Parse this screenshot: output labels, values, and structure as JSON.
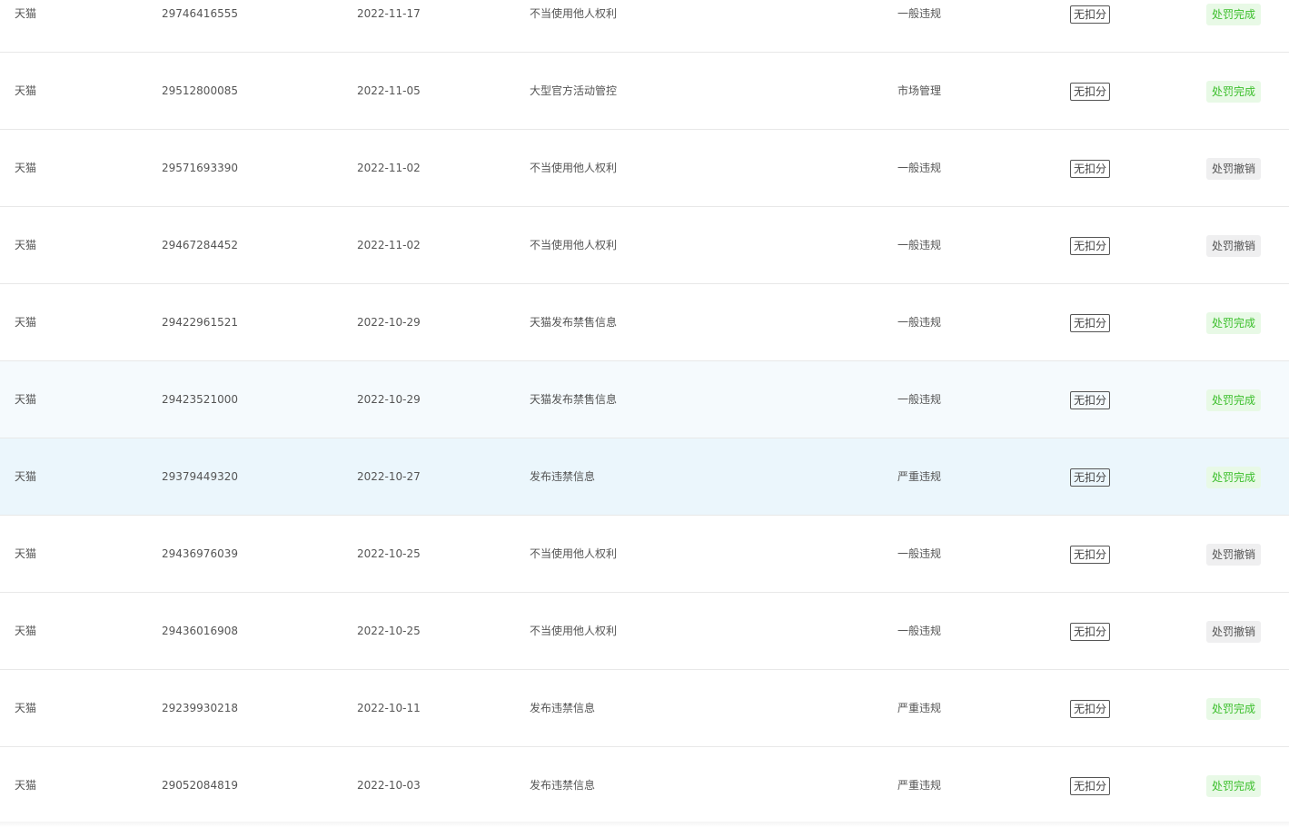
{
  "rows": [
    {
      "platform": "天猫",
      "id": "29746416555",
      "date": "2022-11-17",
      "reason": "不当使用他人权利",
      "level": "一般违规",
      "score": "无扣分",
      "status": "处罚完成",
      "status_type": "done"
    },
    {
      "platform": "天猫",
      "id": "29512800085",
      "date": "2022-11-05",
      "reason": "大型官方活动管控",
      "level": "市场管理",
      "score": "无扣分",
      "status": "处罚完成",
      "status_type": "done"
    },
    {
      "platform": "天猫",
      "id": "29571693390",
      "date": "2022-11-02",
      "reason": "不当使用他人权利",
      "level": "一般违规",
      "score": "无扣分",
      "status": "处罚撤销",
      "status_type": "revoked"
    },
    {
      "platform": "天猫",
      "id": "29467284452",
      "date": "2022-11-02",
      "reason": "不当使用他人权利",
      "level": "一般违规",
      "score": "无扣分",
      "status": "处罚撤销",
      "status_type": "revoked"
    },
    {
      "platform": "天猫",
      "id": "29422961521",
      "date": "2022-10-29",
      "reason": "天猫发布禁售信息",
      "level": "一般违规",
      "score": "无扣分",
      "status": "处罚完成",
      "status_type": "done"
    },
    {
      "platform": "天猫",
      "id": "29423521000",
      "date": "2022-10-29",
      "reason": "天猫发布禁售信息",
      "level": "一般违规",
      "score": "无扣分",
      "status": "处罚完成",
      "status_type": "done"
    },
    {
      "platform": "天猫",
      "id": "29379449320",
      "date": "2022-10-27",
      "reason": "发布违禁信息",
      "level": "严重违规",
      "score": "无扣分",
      "status": "处罚完成",
      "status_type": "done"
    },
    {
      "platform": "天猫",
      "id": "29436976039",
      "date": "2022-10-25",
      "reason": "不当使用他人权利",
      "level": "一般违规",
      "score": "无扣分",
      "status": "处罚撤销",
      "status_type": "revoked"
    },
    {
      "platform": "天猫",
      "id": "29436016908",
      "date": "2022-10-25",
      "reason": "不当使用他人权利",
      "level": "一般违规",
      "score": "无扣分",
      "status": "处罚撤销",
      "status_type": "revoked"
    },
    {
      "platform": "天猫",
      "id": "29239930218",
      "date": "2022-10-11",
      "reason": "发布违禁信息",
      "level": "严重违规",
      "score": "无扣分",
      "status": "处罚完成",
      "status_type": "done"
    },
    {
      "platform": "天猫",
      "id": "29052084819",
      "date": "2022-10-03",
      "reason": "发布违禁信息",
      "level": "严重违规",
      "score": "无扣分",
      "status": "处罚完成",
      "status_type": "done"
    }
  ],
  "colors": {
    "status_done_bg": "#e8f9e6",
    "status_done_text": "#3cbf2c",
    "status_revoked_bg": "#efeff0",
    "status_revoked_text": "#555555",
    "row_highlight_light": "#f5fafd",
    "row_highlight_selected": "#ebf6fc"
  }
}
